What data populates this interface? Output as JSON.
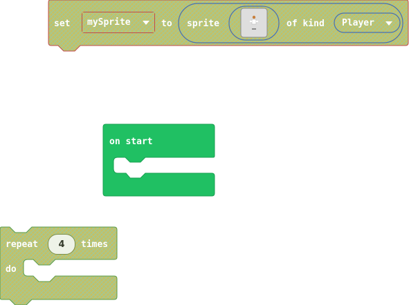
{
  "set_block": {
    "set_label": "set",
    "variable": "mySprite",
    "to_label": "to",
    "sprite_label": "sprite",
    "of_kind_label": "of kind",
    "kind": "Player"
  },
  "on_start_block": {
    "label": "on start"
  },
  "repeat_block": {
    "repeat_label": "repeat",
    "count": "4",
    "times_label": "times",
    "do_label": "do"
  },
  "colors": {
    "disabled_fill": "#c6bf62",
    "disabled_hatch": "#9fc79c",
    "set_outline": "#c24a4a",
    "repeat_outline": "#5a9a46",
    "on_start_fill": "#20c063",
    "on_start_outline": "#18a050"
  }
}
